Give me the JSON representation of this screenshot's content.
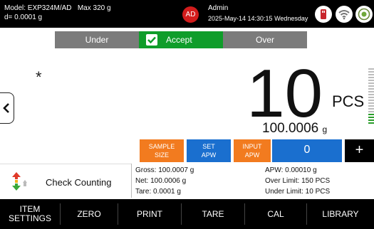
{
  "header": {
    "model_line": "Model: EXP324M/AD",
    "max_line": "Max 320 g",
    "d_line": "d= 0.0001 g",
    "avatar_initials": "AD",
    "user_name": "Admin",
    "datetime": "2025-May-14 14:30:15 Wednesday",
    "icons": [
      "usb-drive-icon",
      "wifi-icon",
      "level-bubble-icon"
    ]
  },
  "status_strip": {
    "under": "Under",
    "accept": "Accept",
    "over": "Over",
    "active": "accept"
  },
  "display": {
    "stability_mark": "*",
    "count_value": "10",
    "count_unit": "PCS",
    "net_weight": "100.0006",
    "net_unit": "g"
  },
  "function_buttons": {
    "sample_size": [
      "SAMPLE",
      "SIZE"
    ],
    "set_apw": [
      "SET",
      "APW"
    ],
    "input_apw": [
      "INPUT",
      "APW"
    ],
    "apw_value": "0",
    "plus": "+"
  },
  "mode": {
    "label": "Check Counting"
  },
  "info": {
    "gross": "Gross: 100.0007 g",
    "net": "Net: 100.0006 g",
    "tare": "Tare: 0.0001 g",
    "apw": "APW: 0.00010 g",
    "over_limit": "Over Limit: 150 PCS",
    "under_limit": "Under Limit: 10 PCS"
  },
  "bottom_bar": {
    "item_settings": [
      "ITEM",
      "SETTINGS"
    ],
    "zero": "ZERO",
    "print": "PRINT",
    "tare": "TARE",
    "cal": "CAL",
    "library": "LIBRARY"
  },
  "colors": {
    "accept_green": "#0f9d2a",
    "inactive_gray": "#7b7b7b",
    "orange": "#f27b1f",
    "blue": "#1a6fcf",
    "avatar_red": "#d21c1c",
    "bargraph_green": "#2a9d2a"
  }
}
